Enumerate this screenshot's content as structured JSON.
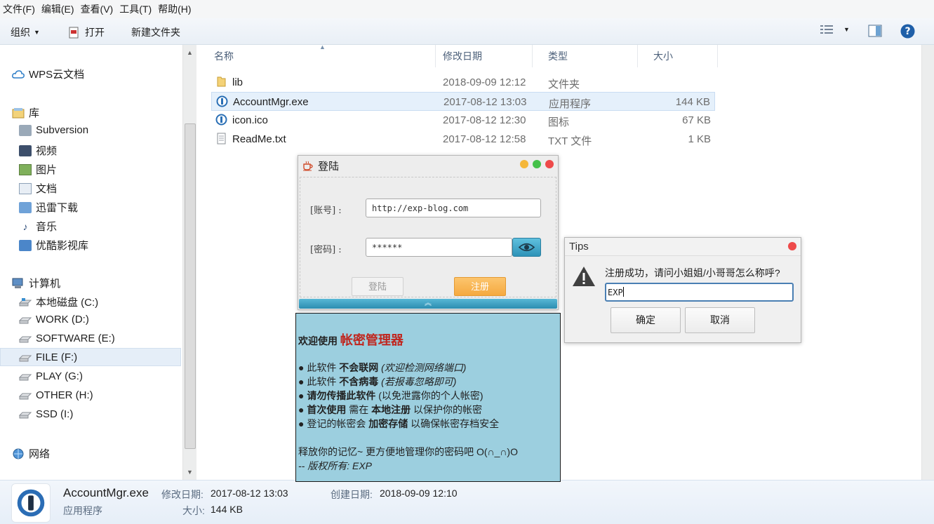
{
  "menu": [
    "文件(F)",
    "编辑(E)",
    "查看(V)",
    "工具(T)",
    "帮助(H)"
  ],
  "toolbar": {
    "organize": "组织",
    "open": "打开",
    "new_folder": "新建文件夹"
  },
  "nav": {
    "wps": "WPS云文档",
    "library": "库",
    "library_items": [
      "Subversion",
      "视频",
      "图片",
      "文档",
      "迅雷下载",
      "音乐",
      "优酷影视库"
    ],
    "computer": "计算机",
    "drives": [
      "本地磁盘 (C:)",
      "WORK (D:)",
      "SOFTWARE (E:)",
      "FILE (F:)",
      "PLAY (G:)",
      "OTHER (H:)",
      "SSD (I:)"
    ],
    "selected_drive": "FILE (F:)",
    "network": "网络"
  },
  "columns": {
    "name": "名称",
    "date": "修改日期",
    "type": "类型",
    "size": "大小"
  },
  "files": [
    {
      "name": "lib",
      "date": "2018-09-09 12:12",
      "type": "文件夹",
      "size": ""
    },
    {
      "name": "AccountMgr.exe",
      "date": "2017-08-12 13:03",
      "type": "应用程序",
      "size": "144 KB"
    },
    {
      "name": "icon.ico",
      "date": "2017-08-12 12:30",
      "type": "图标",
      "size": "67 KB"
    },
    {
      "name": "ReadMe.txt",
      "date": "2017-08-12 12:58",
      "type": "TXT 文件",
      "size": "1 KB"
    }
  ],
  "details": {
    "filename": "AccountMgr.exe",
    "filetype": "应用程序",
    "modified_label": "修改日期:",
    "modified": "2017-08-12 13:03",
    "created_label": "创建日期:",
    "created": "2018-09-09 12:10",
    "size_label": "大小:",
    "size": "144 KB"
  },
  "login": {
    "title": "登陆",
    "account_label": "[账号] :",
    "account_value": "http://exp-blog.com",
    "password_label": "[密码] :",
    "password_value": "******",
    "login_button": "登陆",
    "register_button": "注册",
    "footer_glyph": "︽"
  },
  "info": {
    "welcome": "欢迎使用 ",
    "brand": "帐密管理器",
    "lines": [
      {
        "a": "● 此软件 ",
        "b": "不会联网",
        "c": " (欢迎检测网络端口)",
        "c_italic": true
      },
      {
        "a": "● 此软件 ",
        "b": "不含病毒",
        "c": " (若报毒忽略即可)",
        "c_italic": true
      },
      {
        "a": "● ",
        "b": "请勿传播此软件",
        "c": " (以免泄露你的个人帐密)",
        "c_italic": false
      },
      {
        "a": "● ",
        "b": "首次使用",
        "c": " 需在 ",
        "b2": "本地注册",
        "c2": " 以保护你的帐密"
      },
      {
        "a": "● 登记的帐密会 ",
        "b": "加密存储",
        "c": " 以确保帐密存档安全",
        "c_italic": false
      }
    ],
    "footer1": "释放你的记忆~ 更方便地管理你的密码吧 O(∩_∩)O",
    "footer2": "-- 版权所有: EXP"
  },
  "tips": {
    "title": "Tips",
    "message": "注册成功，请问小姐姐/小哥哥怎么称呼?",
    "input_value": "EXP",
    "ok": "确定",
    "cancel": "取消"
  },
  "colors": {
    "accent": "#3a8fc1",
    "login_register": "#f7b554",
    "info_bg": "#9ccfdf",
    "brand_red": "#c0271f"
  }
}
